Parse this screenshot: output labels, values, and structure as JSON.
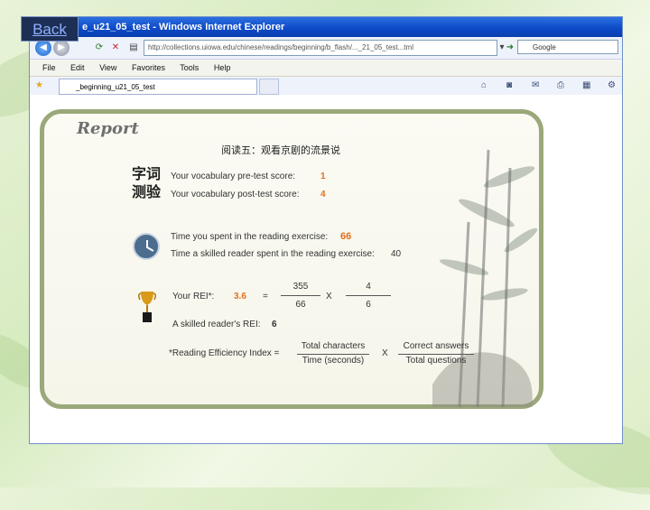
{
  "overlay": {
    "back_label": "Back"
  },
  "browser": {
    "title": "e_u21_05_test - Windows Internet Explorer",
    "address": "http://collections.uiowa.edu/chinese/readings/beginning/b_flash/..._21_05_test...tml",
    "search": "Google",
    "menu": [
      "File",
      "Edit",
      "View",
      "Favorites",
      "Tools",
      "Help"
    ],
    "tab_label": "_beginning_u21_05_test"
  },
  "report": {
    "title": "Report",
    "heading": "阅读五：观看京剧的流景说",
    "vocab_icon_text": "字词 测验",
    "pre_test_label": "Your vocabulary pre-test score:",
    "pre_test_value": "1",
    "post_test_label": "Your vocabulary post-test score:",
    "post_test_value": "4",
    "time_spent_label": "Time you spent in the reading exercise:",
    "time_spent_value": "66",
    "skilled_time_label": "Time a skilled reader spent in the reading exercise:",
    "skilled_time_value": "40",
    "rei_label": "Your REI*:",
    "rei_value": "3.6",
    "equals": "=",
    "frac1_num": "355",
    "frac1_den": "66",
    "times": "X",
    "frac2_num": "4",
    "frac2_den": "6",
    "skilled_rei_label": "A skilled reader's REI:",
    "skilled_rei_value": "6",
    "formula_label": "*Reading Efficiency Index =",
    "formula_num1": "Total characters",
    "formula_den1": "Time (seconds)",
    "formula_times": "X",
    "formula_num2": "Correct answers",
    "formula_den2": "Total questions"
  }
}
